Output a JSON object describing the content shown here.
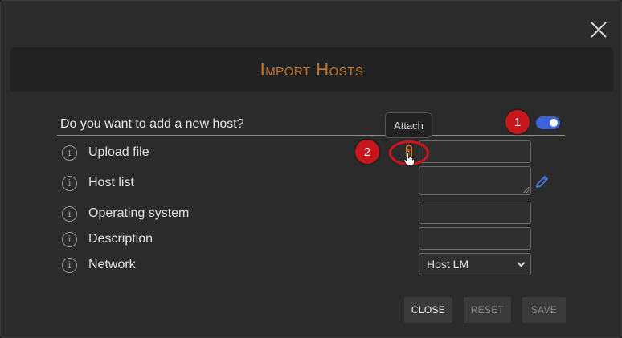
{
  "dialog": {
    "title": "Import Hosts",
    "question": "Do you want to add a new host?",
    "toggle_on": true,
    "accent_color": "#c8752a",
    "toggle_color": "#3d63d8"
  },
  "tooltip": {
    "text": "Attach"
  },
  "badges": {
    "first": "1",
    "second": "2"
  },
  "rows": [
    {
      "label": "Upload file"
    },
    {
      "label": "Host list"
    },
    {
      "label": "Operating system"
    },
    {
      "label": "Description"
    },
    {
      "label": "Network"
    }
  ],
  "network": {
    "selected": "Host LM"
  },
  "buttons": {
    "close": "CLOSE",
    "reset": "RESET",
    "save": "SAVE"
  },
  "icons": {
    "info": "info-icon",
    "attach": "paperclip-icon",
    "edit": "pencil-icon",
    "cursor": "hand-pointer-icon",
    "dismiss": "close-icon"
  }
}
